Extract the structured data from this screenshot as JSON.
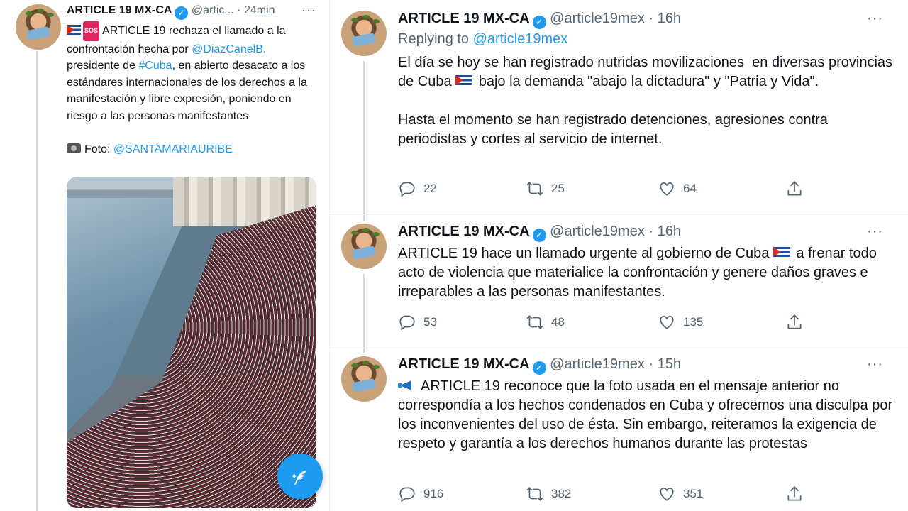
{
  "left_tweet": {
    "name": "ARTICLE 19 MX-CA",
    "handle": "@artic...",
    "sep": "·",
    "time": "24min",
    "text_1": "ARTICLE 19 rechaza el llamado a la confrontación hecha por ",
    "mention_1": "@DiazCanelB",
    "text_2": ", presidente de ",
    "hashtag": "#Cuba",
    "text_3": ", en abierto desacato a los estándares internacionales de los derechos a la manifestación y libre expresión, poniendo en riesgo a las personas manifestantes",
    "photo_label": "Foto: ",
    "photo_credit": "@SANTAMARIAURIBE",
    "sos_icon": "SOS"
  },
  "tweets": [
    {
      "name": "ARTICLE 19 MX-CA",
      "handle": "@article19mex",
      "sep": "·",
      "time": "16h",
      "replying_label": "Replying to ",
      "replying_handle": "@article19mex",
      "body_1": "El día se hoy se han registrado nutridas movilizaciones  en diversas provincias de Cuba ",
      "body_2": " bajo la demanda \"abajo la dictadura\" y \"Patria y Vida\".\n\nHasta el momento se han registrado detenciones, agresiones contra periodistas y cortes al servicio de internet.",
      "replies": "22",
      "retweets": "25",
      "likes": "64"
    },
    {
      "name": "ARTICLE 19 MX-CA",
      "handle": "@article19mex",
      "sep": "·",
      "time": "16h",
      "body_1": "ARTICLE 19 hace un llamado urgente al gobierno de Cuba ",
      "body_2": " a frenar todo acto de violencia que materialice la confrontación y genere daños graves e irreparables a las personas manifestantes.",
      "replies": "53",
      "retweets": "48",
      "likes": "135"
    },
    {
      "name": "ARTICLE 19 MX-CA",
      "handle": "@article19mex",
      "sep": "·",
      "time": "15h",
      "body": "ARTICLE 19 reconoce que la foto usada en el mensaje anterior no correspondía a los hechos condenados en Cuba y ofrecemos una disculpa por los inconvenientes del uso de ésta. Sin embargo, reiteramos la exigencia de respeto y garantía a los derechos humanos durante las protestas",
      "replies": "916",
      "retweets": "382",
      "likes": "351"
    }
  ],
  "icons": {
    "more": "···",
    "verified": "✓",
    "fab": "compose-tweet-icon"
  },
  "colors": {
    "accent": "#1d9bf0",
    "muted": "#536471",
    "text": "#0f1419"
  }
}
